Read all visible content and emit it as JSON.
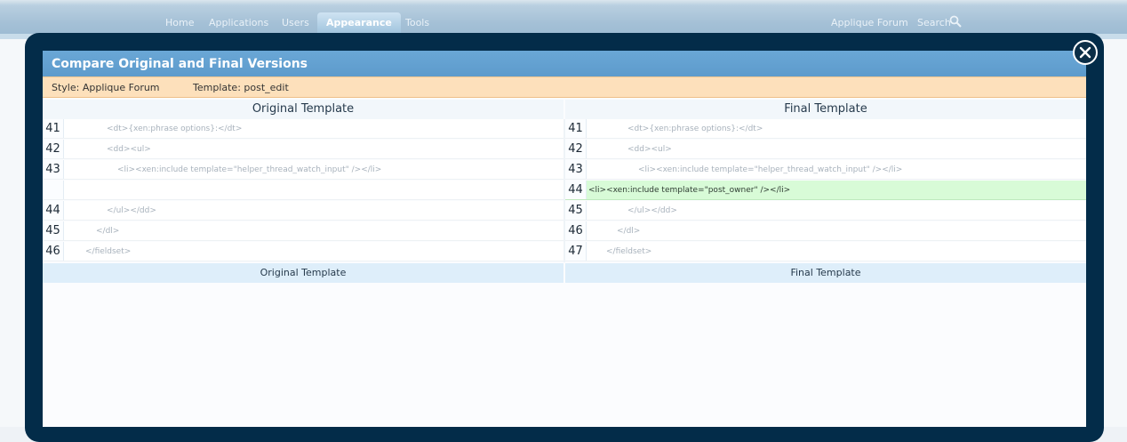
{
  "nav": {
    "tabs": [
      "Home",
      "Applications",
      "Users",
      "Appearance",
      "Tools"
    ],
    "active_tab": "Appearance",
    "site_link": "Applique Forum",
    "search_label": "Search"
  },
  "overlay": {
    "title": "Compare Original and Final Versions",
    "style_label": "Style: Applique Forum",
    "template_label": "Template: post_edit",
    "close_icon": "close-icon"
  },
  "original": {
    "header": "Original Template",
    "footer": "Original Template",
    "rows": [
      {
        "line": "41",
        "code": "<dt>{xen:phrase options}:</dt>"
      },
      {
        "line": "42",
        "code": "<dd><ul>"
      },
      {
        "line": "43",
        "code": "<li><xen:include template=\"helper_thread_watch_input\" /></li>"
      },
      {
        "line": "",
        "code": ""
      },
      {
        "line": "44",
        "code": "</ul></dd>"
      },
      {
        "line": "45",
        "code": "</dl>"
      },
      {
        "line": "46",
        "code": "</fieldset>"
      }
    ]
  },
  "final": {
    "header": "Final Template",
    "footer": "Final Template",
    "rows": [
      {
        "line": "41",
        "code": "<dt>{xen:phrase options}:</dt>"
      },
      {
        "line": "42",
        "code": "<dd><ul>"
      },
      {
        "line": "43",
        "code": "<li><xen:include template=\"helper_thread_watch_input\" /></li>"
      },
      {
        "line": "44",
        "code": "<li><xen:include template=\"post_owner\" /></li>"
      },
      {
        "line": "45",
        "code": "</ul></dd>"
      },
      {
        "line": "46",
        "code": "</dl>"
      },
      {
        "line": "47",
        "code": "</fieldset>"
      }
    ]
  },
  "colors": {
    "overlay_frame": "#032c49",
    "title_bar": "#5d9bcc",
    "info_bar": "#fde0bb",
    "added_line": "#d8fbd7"
  }
}
